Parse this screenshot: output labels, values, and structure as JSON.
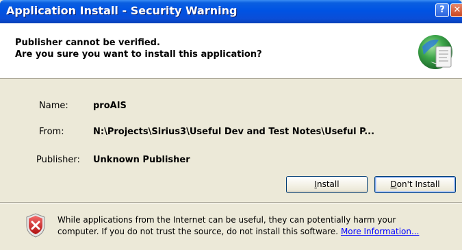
{
  "window": {
    "title": "Application Install - Security Warning",
    "accent": "#0053e3"
  },
  "header": {
    "line1": "Publisher cannot be verified.",
    "line2": "Are you sure you want to install this application?"
  },
  "details": {
    "name_label": "Name:",
    "name_value": "proAIS",
    "from_label": "From:",
    "from_value": "N:\\Projects\\Sirius3\\Useful Dev and Test Notes\\Useful P...",
    "publisher_label": "Publisher:",
    "publisher_value": "Unknown Publisher"
  },
  "buttons": {
    "install_prefix": "",
    "install_accel": "I",
    "install_rest": "nstall",
    "dont_accel": "D",
    "dont_rest": "on't Install"
  },
  "footer": {
    "line1": "While applications from the Internet can be useful, they can potentially harm your",
    "line2": "computer. If you do not trust the source, do not install this software.",
    "link": "More Information..."
  }
}
